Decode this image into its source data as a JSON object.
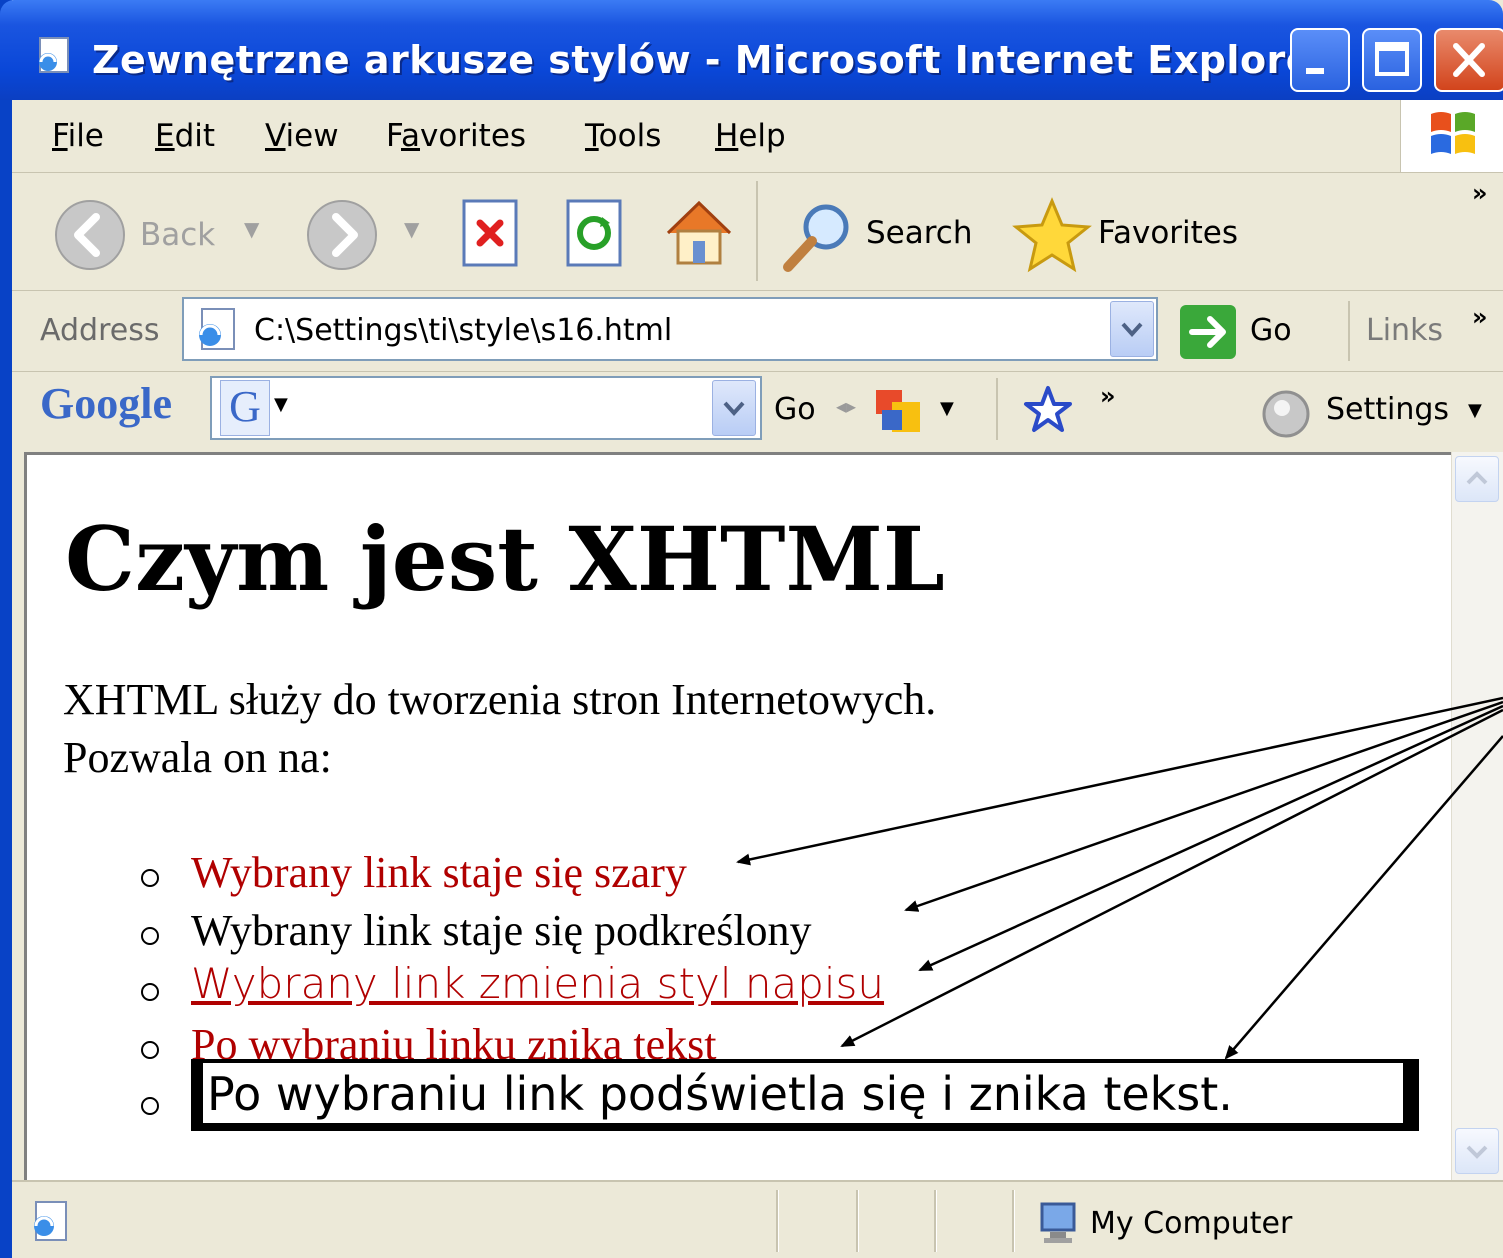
{
  "window": {
    "title": "Zewnętrzne arkusze stylów - Microsoft Internet Explorer"
  },
  "menu": [
    {
      "label": "File"
    },
    {
      "label": "Edit"
    },
    {
      "label": "View"
    },
    {
      "label": "Favorites"
    },
    {
      "label": "Tools"
    },
    {
      "label": "Help"
    }
  ],
  "toolbar": {
    "back_label": "Back",
    "search_label": "Search",
    "favorites_label": "Favorites",
    "more": "»"
  },
  "address": {
    "label": "Address",
    "value": "C:\\Settings\\ti\\style\\s16.html",
    "go_label": "Go",
    "links_label": "Links",
    "more": "»"
  },
  "google": {
    "logo": "Google",
    "g_label": "G",
    "search_value": "",
    "go_label": "Go",
    "more": "»",
    "settings_label": "Settings"
  },
  "page": {
    "heading": "Czym jest XHTML",
    "intro_line1": "XHTML służy do tworzenia stron Internetowych.",
    "intro_line2": "Pozwala on na:",
    "items": [
      {
        "text": "Wybrany link staje się szary"
      },
      {
        "text": "Wybrany link staje się podkreślony"
      },
      {
        "text": "Wybrany link zmienia styl napisu"
      },
      {
        "text": "Po wybraniu linku znika tekst"
      },
      {
        "text": "Po wybraniu link podświetla się i znika tekst."
      }
    ]
  },
  "status": {
    "zone": "My Computer"
  },
  "colors": {
    "titlebar": "#0a47d8",
    "chrome": "#ece9d8",
    "link_red": "#b00000"
  }
}
